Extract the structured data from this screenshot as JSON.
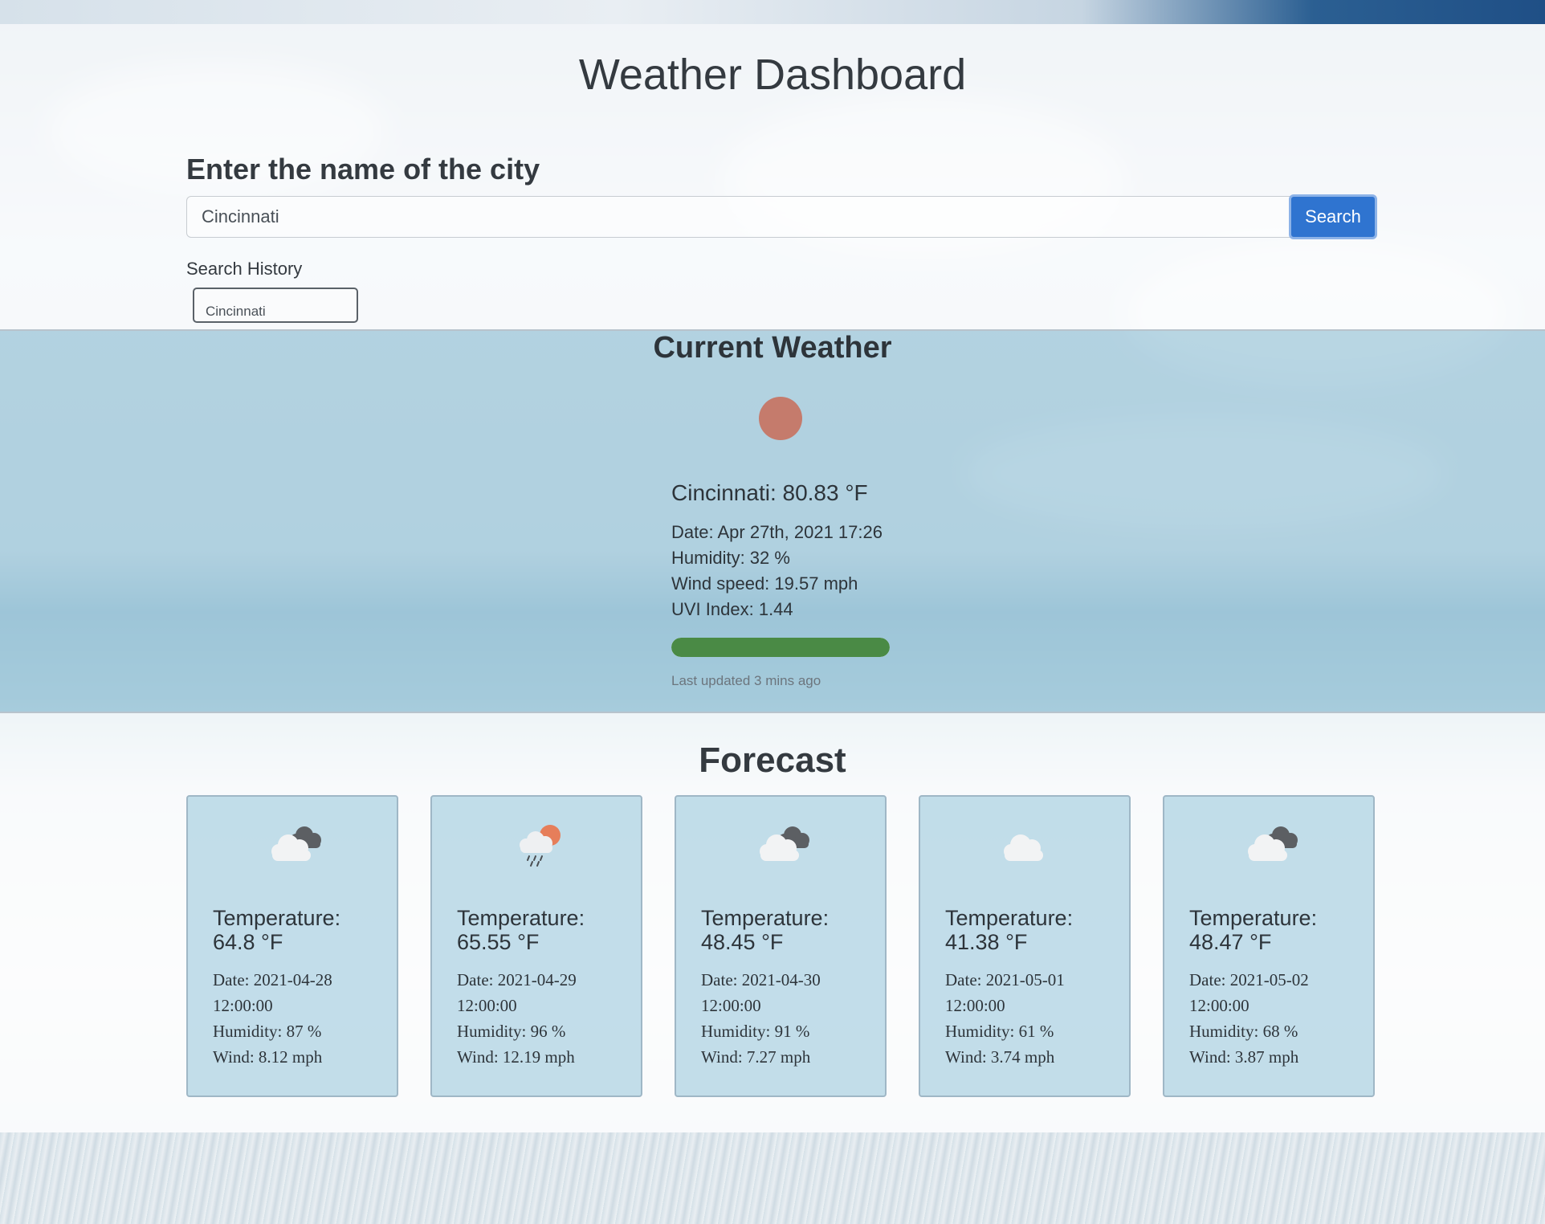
{
  "header": {
    "title": "Weather Dashboard",
    "prompt": "Enter the name of the city",
    "search_value": "Cincinnati",
    "search_button": "Search",
    "history_label": "Search History",
    "history": [
      "Cincinnati"
    ]
  },
  "current": {
    "title": "Current Weather",
    "icon": "sun-icon",
    "headline": "Cincinnati: 80.83 °F",
    "date": "Date: Apr 27th, 2021 17:26",
    "humidity": "Humidity: 32 %",
    "wind": "Wind speed: 19.57 mph",
    "uvi": "UVI Index: 1.44",
    "uvi_bar_fraction": 1.0,
    "uvi_bar_color": "#4a8a45",
    "updated": "Last updated 3 mins ago"
  },
  "forecast": {
    "title": "Forecast",
    "temp_label": "Temperature:",
    "cards": [
      {
        "icon": "broken-clouds-icon",
        "temp": "64.8 °F",
        "date": "Date: 2021-04-28",
        "time": "12:00:00",
        "humidity": "Humidity: 87 %",
        "wind": "Wind: 8.12 mph"
      },
      {
        "icon": "rain-sun-icon",
        "temp": "65.55 °F",
        "date": "Date: 2021-04-29",
        "time": "12:00:00",
        "humidity": "Humidity: 96 %",
        "wind": "Wind: 12.19 mph"
      },
      {
        "icon": "broken-clouds-icon",
        "temp": "48.45 °F",
        "date": "Date: 2021-04-30",
        "time": "12:00:00",
        "humidity": "Humidity: 91 %",
        "wind": "Wind: 7.27 mph"
      },
      {
        "icon": "cloud-icon",
        "temp": "41.38 °F",
        "date": "Date: 2021-05-01",
        "time": "12:00:00",
        "humidity": "Humidity: 61 %",
        "wind": "Wind: 3.74 mph"
      },
      {
        "icon": "broken-clouds-icon",
        "temp": "48.47 °F",
        "date": "Date: 2021-05-02",
        "time": "12:00:00",
        "humidity": "Humidity: 68 %",
        "wind": "Wind: 3.87 mph"
      }
    ]
  }
}
